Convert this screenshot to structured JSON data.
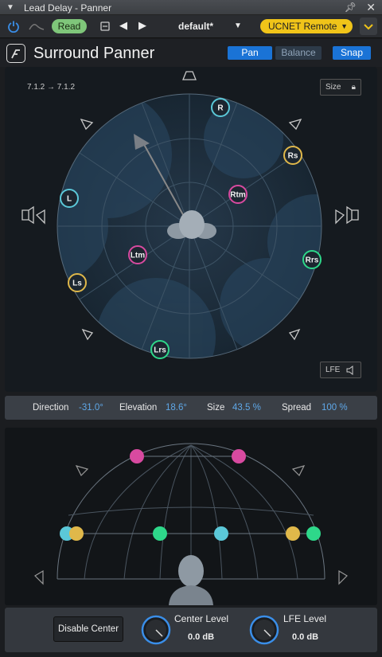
{
  "window": {
    "title": "Lead Delay - Panner"
  },
  "toolbar": {
    "read_label": "Read",
    "preset_name": "default*",
    "remote_label": "UCNET Remote"
  },
  "panel": {
    "title": "Surround Panner",
    "pan_label": "Pan",
    "balance_label": "Balance",
    "snap_label": "Snap",
    "format_label": "7.1.2 → 7.1.2",
    "size_label": "Size",
    "lfe_label": "LFE"
  },
  "channels": [
    {
      "label": "R",
      "color": "#5bc8d8"
    },
    {
      "label": "Rs",
      "color": "#e0b84a"
    },
    {
      "label": "Rtm",
      "color": "#d84aa0"
    },
    {
      "label": "L",
      "color": "#5bc8d8"
    },
    {
      "label": "Ltm",
      "color": "#d84aa0"
    },
    {
      "label": "Rrs",
      "color": "#2ed88a"
    },
    {
      "label": "Ls",
      "color": "#e0b84a"
    },
    {
      "label": "Lrs",
      "color": "#2ed88a"
    }
  ],
  "params": {
    "direction_label": "Direction",
    "direction_value": "-31.0°",
    "elevation_label": "Elevation",
    "elevation_value": "18.6°",
    "size_label": "Size",
    "size_value": "43.5 %",
    "spread_label": "Spread",
    "spread_value": "100 %"
  },
  "footer": {
    "disable_center_label": "Disable Center",
    "center_level_label": "Center Level",
    "center_level_value": "0.0 dB",
    "lfe_level_label": "LFE Level",
    "lfe_level_value": "0.0 dB"
  },
  "colors": {
    "accent_blue": "#1a73d6",
    "read_green": "#7fc67a",
    "remote_yellow": "#f0c419"
  }
}
